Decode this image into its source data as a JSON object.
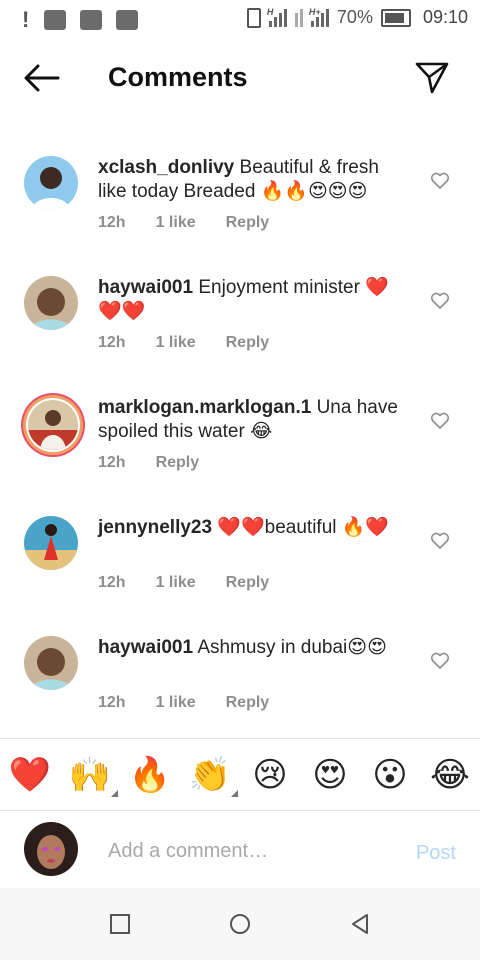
{
  "status_bar": {
    "battery": "70%",
    "time": "09:10",
    "network_a": "H",
    "network_b": "H+"
  },
  "header": {
    "title": "Comments",
    "back_icon": "arrow-left-icon",
    "send_icon": "paper-plane-icon"
  },
  "comments": [
    {
      "username": "xclash_donlivy",
      "text": "Beautiful & fresh like today Breaded 🔥🔥😍😍😍",
      "time": "12h",
      "likes": "1 like",
      "reply": "Reply"
    },
    {
      "username": "haywai001",
      "text": "Enjoyment minister ❤️❤️❤️",
      "time": "12h",
      "likes": "1 like",
      "reply": "Reply"
    },
    {
      "username": "marklogan.marklogan.1",
      "text": "Una have spoiled this water 😂",
      "time": "12h",
      "likes": "",
      "reply": "Reply"
    },
    {
      "username": "jennynelly23",
      "text": "❤️❤️beautiful 🔥❤️",
      "time": "12h",
      "likes": "1 like",
      "reply": "Reply"
    },
    {
      "username": "haywai001",
      "text": "Ashmusy in dubai😍😍",
      "time": "12h",
      "likes": "1 like",
      "reply": "Reply"
    }
  ],
  "emoji_bar": [
    {
      "glyph": "❤️",
      "name": "red-heart"
    },
    {
      "glyph": "🙌",
      "name": "raising-hands"
    },
    {
      "glyph": "🔥",
      "name": "fire"
    },
    {
      "glyph": "👏",
      "name": "clapping-hands"
    },
    {
      "glyph": "😢",
      "name": "crying-face"
    },
    {
      "glyph": "😍",
      "name": "heart-eyes"
    },
    {
      "glyph": "😮",
      "name": "surprised-face"
    },
    {
      "glyph": "😂",
      "name": "tears-of-joy"
    }
  ],
  "composer": {
    "placeholder": "Add a comment…",
    "post_label": "Post"
  },
  "colors": {
    "post_disabled": "#b3d8f8",
    "meta_gray": "#8e8e8e",
    "story_ring": "#e94f6d"
  }
}
